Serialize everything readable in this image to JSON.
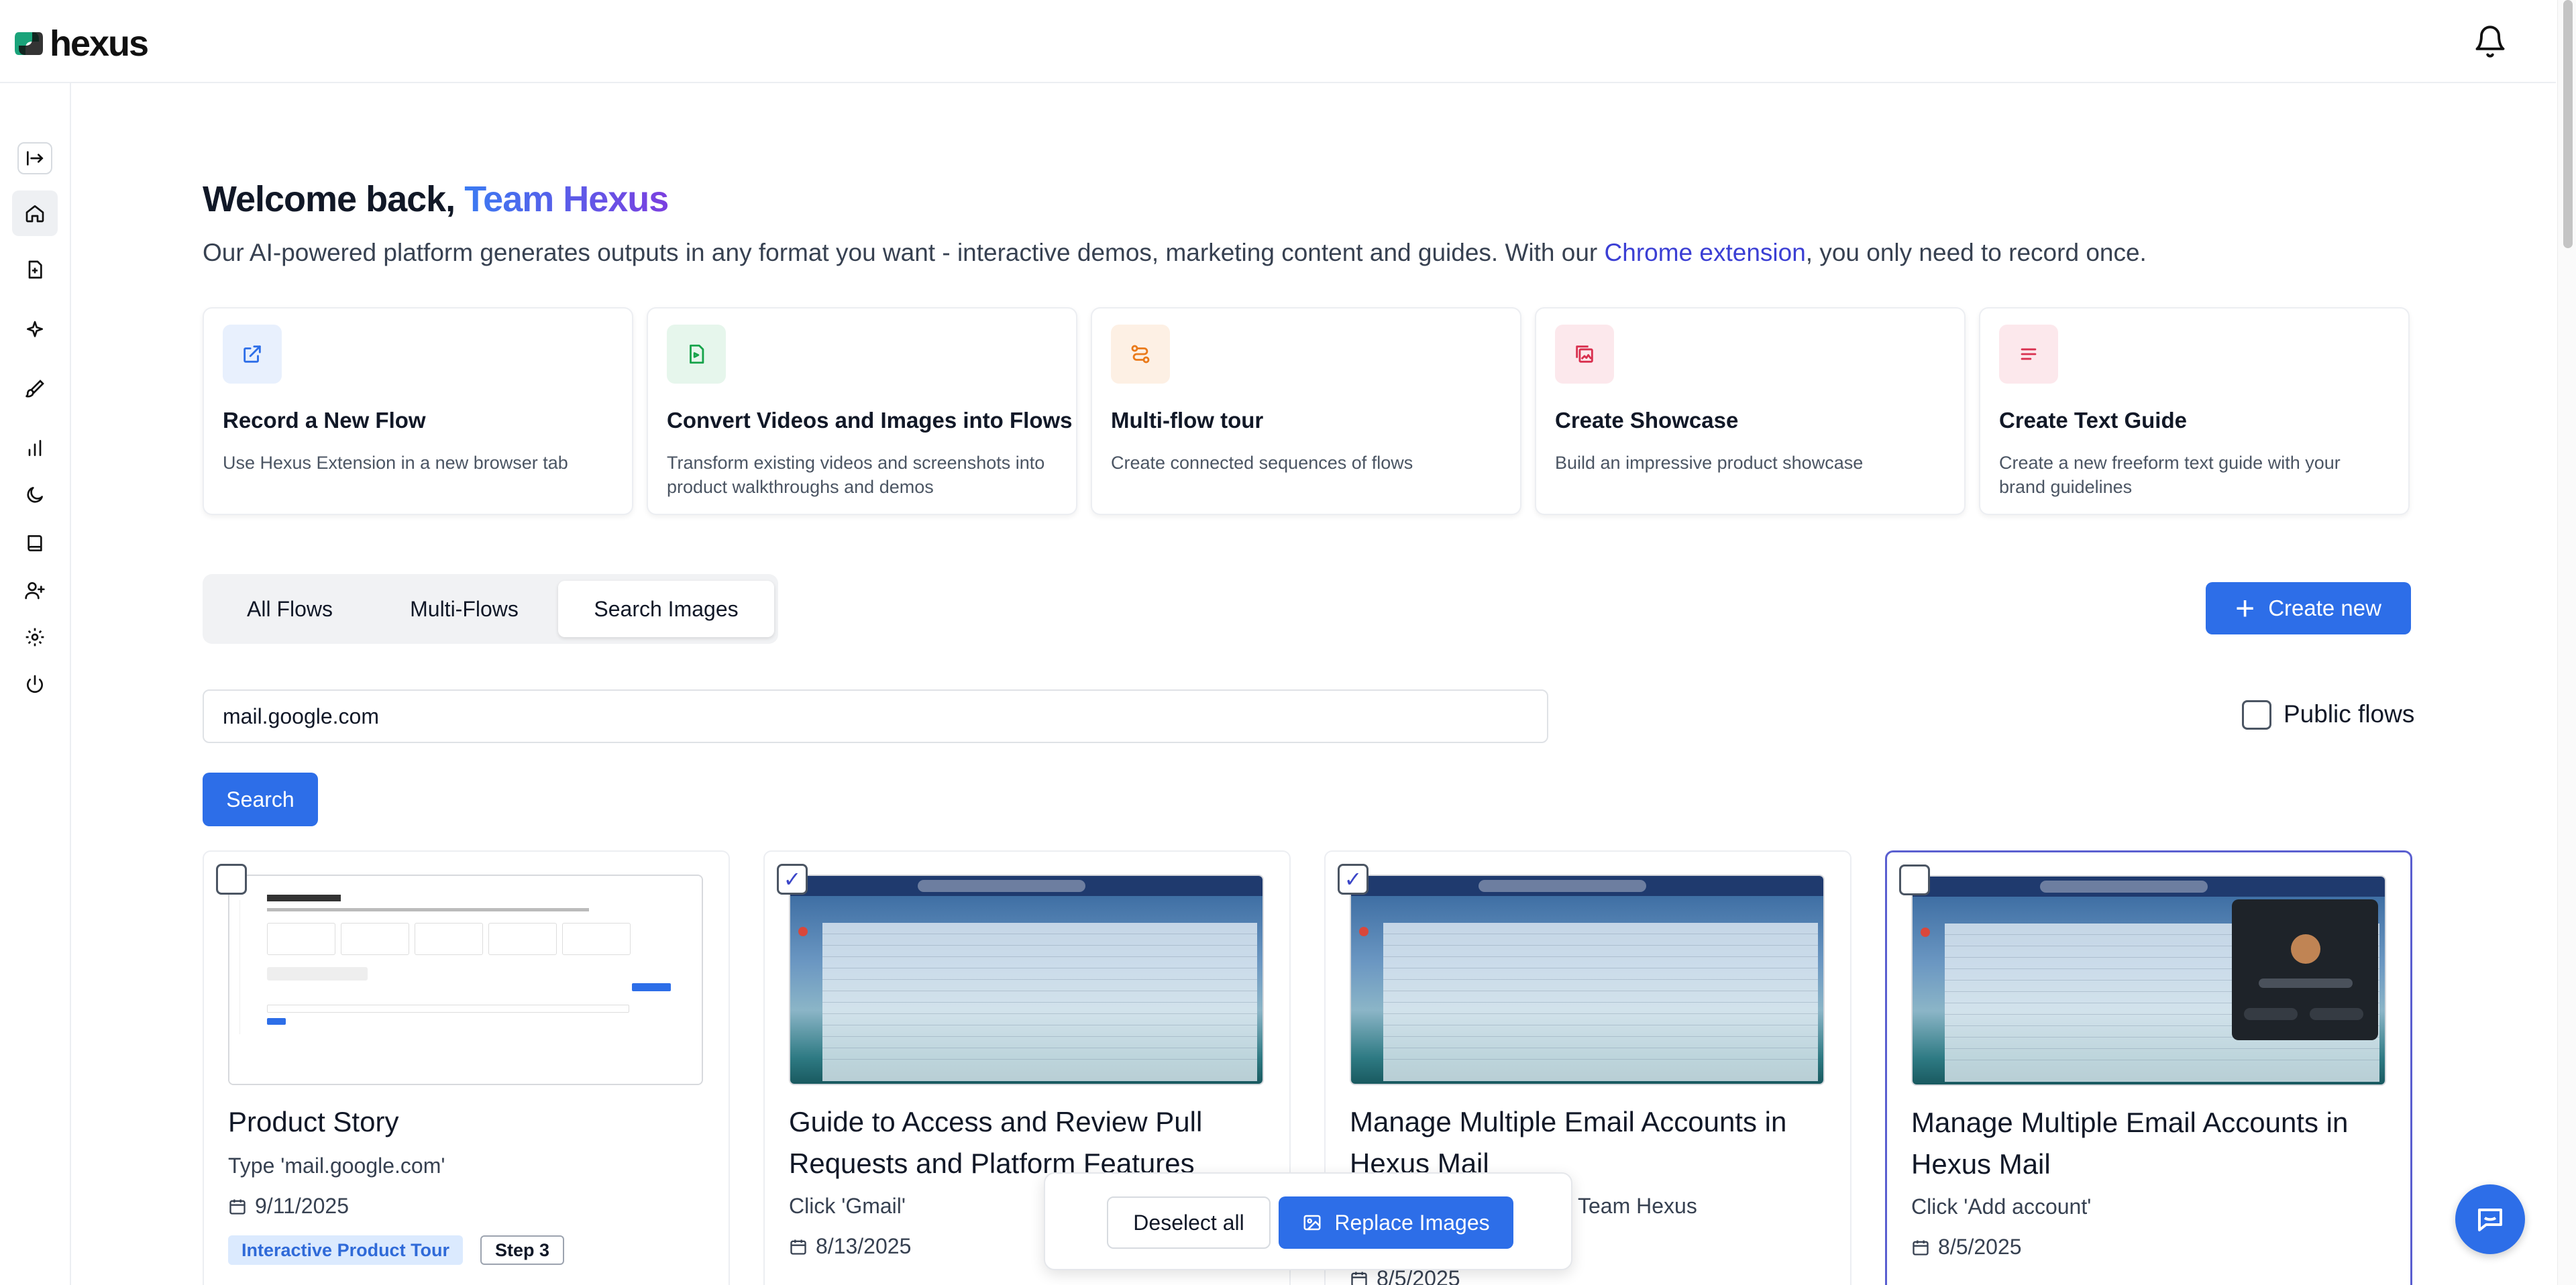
{
  "app": {
    "brand": "hexus"
  },
  "header": {
    "welcome_prefix": "Welcome back, ",
    "welcome_team": "Team Hexus"
  },
  "subtitle": {
    "before": "Our AI-powered platform generates outputs in any format you want - interactive demos, marketing content and guides. With our ",
    "link": "Chrome extension",
    "after": ", you only need to record once."
  },
  "quick_actions": [
    {
      "title": "Record a New Flow",
      "desc": "Use Hexus Extension in a new browser tab",
      "icon": "external-link-icon",
      "color": "#2d6ee8",
      "bg": "#e8f0fd"
    },
    {
      "title": "Convert Videos and Images into Flows",
      "desc": "Transform existing videos and screenshots into product walkthroughs and demos",
      "icon": "file-convert-icon",
      "color": "#16a34a",
      "bg": "#e6f6ec"
    },
    {
      "title": "Multi-flow tour",
      "desc": "Create connected sequences of flows",
      "icon": "route-icon",
      "color": "#ea7a1a",
      "bg": "#fdf0e4"
    },
    {
      "title": "Create Showcase",
      "desc": "Build an impressive product showcase",
      "icon": "gallery-icon",
      "color": "#d9304f",
      "bg": "#fce8ec"
    },
    {
      "title": "Create Text Guide",
      "desc": "Create a new freeform text guide with your brand guidelines",
      "icon": "text-lines-icon",
      "color": "#d9304f",
      "bg": "#fce8ec"
    }
  ],
  "tabs": {
    "all": "All Flows",
    "multi": "Multi-Flows",
    "images": "Search Images",
    "active": "Search Images"
  },
  "toolbar": {
    "create_label": "Create new"
  },
  "search": {
    "value": "mail.google.com",
    "public_label": "Public flows",
    "button": "Search"
  },
  "cards": [
    {
      "title": "Product Story",
      "subtitle": "Type 'mail.google.com'",
      "date": "9/11/2025",
      "badge": "Interactive Product Tour",
      "step": "Step 3",
      "checked": false
    },
    {
      "title": "Guide to Access and Review Pull Requests and Platform Features",
      "subtitle": "Click 'Gmail'",
      "date": "8/13/2025",
      "checked": true
    },
    {
      "title": "Manage Multiple Email Accounts in Hexus Mail",
      "subtitle": "Team Hexus",
      "date": "8/5/2025",
      "checked": true
    },
    {
      "title": "Manage Multiple Email Accounts in Hexus Mail",
      "subtitle": "Click 'Add account'",
      "date": "8/5/2025",
      "checked": false
    }
  ],
  "action_bar": {
    "deselect": "Deselect all",
    "replace": "Replace Images"
  },
  "colors": {
    "accent": "#2d6ee8",
    "brand_gradient_start": "#3a7bf2",
    "brand_gradient_end": "#7b3fe0",
    "link": "#3b3fd4"
  }
}
